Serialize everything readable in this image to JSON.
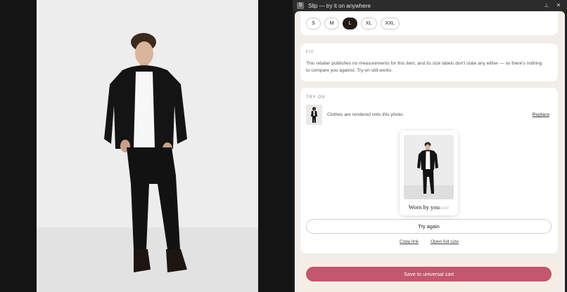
{
  "window": {
    "app_icon": "S",
    "title": "Slip — try it on anywhere",
    "pin_icon": "pin-icon",
    "close_icon": "close-icon"
  },
  "sizes": {
    "options": [
      "S",
      "M",
      "L",
      "XL",
      "XXL"
    ],
    "selected": "L"
  },
  "fit": {
    "label": "FIT",
    "text": "This retailer publishes no measurements for this item, and its size labels don't state any either — so there's nothing to compare you against. Try-on still works."
  },
  "tryon": {
    "label": "TRY ON",
    "description": "Clothes are rendered onto this photo.",
    "replace_label": "Replace",
    "caption": "Worn by you",
    "caption_brand": "H&M",
    "try_again_label": "Try again",
    "copy_link_label": "Copy link",
    "open_full_label": "Open full size"
  },
  "cart": {
    "save_label": "Save to universal cart"
  },
  "colors": {
    "accent": "#c2576d",
    "selected_size": "#231a14",
    "panel_bg": "#f1ede8"
  }
}
